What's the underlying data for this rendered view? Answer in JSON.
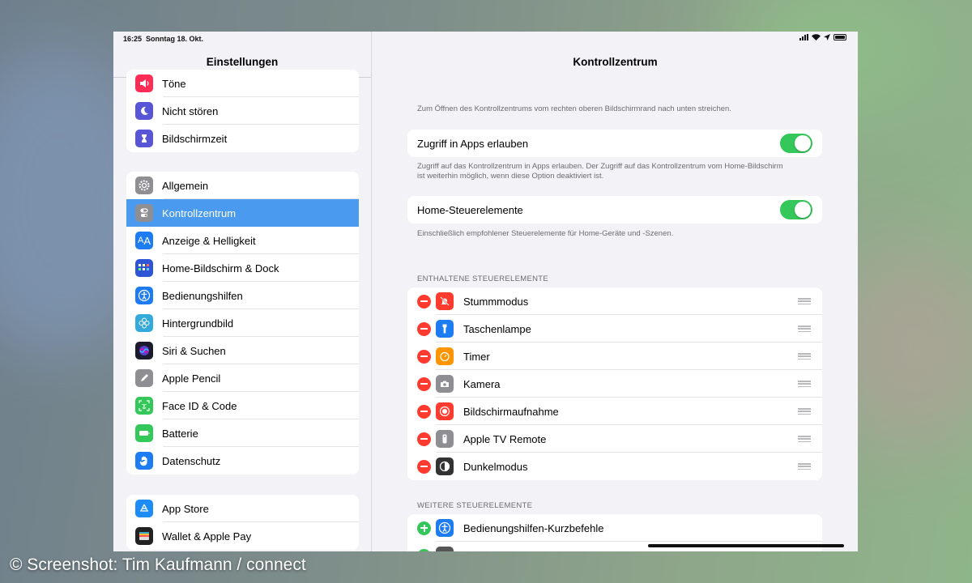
{
  "status": {
    "time": "16:25",
    "date": "Sonntag 18. Okt."
  },
  "sidebar": {
    "title": "Einstellungen",
    "group1": [
      {
        "label": "Töne",
        "icon": "speaker-icon",
        "color": "#ff2d55"
      },
      {
        "label": "Nicht stören",
        "icon": "moon-icon",
        "color": "#5856d6"
      },
      {
        "label": "Bildschirmzeit",
        "icon": "hourglass-icon",
        "color": "#5856d6"
      }
    ],
    "group2": [
      {
        "label": "Allgemein",
        "icon": "gear-icon",
        "color": "#8e8e93"
      },
      {
        "label": "Kontrollzentrum",
        "icon": "switches-icon",
        "color": "#8e8e93",
        "active": true
      },
      {
        "label": "Anzeige & Helligkeit",
        "icon": "text-size-icon",
        "color": "#1e7cf2"
      },
      {
        "label": "Home-Bildschirm & Dock",
        "icon": "app-grid-icon",
        "color": "#2e55d6"
      },
      {
        "label": "Bedienungshilfen",
        "icon": "accessibility-icon",
        "color": "#1e7cf2"
      },
      {
        "label": "Hintergrundbild",
        "icon": "flower-icon",
        "color": "#34aadc"
      },
      {
        "label": "Siri & Suchen",
        "icon": "siri-icon",
        "color": "#222"
      },
      {
        "label": "Apple Pencil",
        "icon": "pencil-icon",
        "color": "#8e8e93"
      },
      {
        "label": "Face ID & Code",
        "icon": "face-id-icon",
        "color": "#34c759"
      },
      {
        "label": "Batterie",
        "icon": "battery-icon",
        "color": "#34c759"
      },
      {
        "label": "Datenschutz",
        "icon": "hand-icon",
        "color": "#1e7cf2"
      }
    ],
    "group3": [
      {
        "label": "App Store",
        "icon": "app-store-icon",
        "color": "#1e8cf7"
      },
      {
        "label": "Wallet & Apple Pay",
        "icon": "wallet-icon",
        "color": "#222"
      }
    ]
  },
  "main": {
    "title": "Kontrollzentrum",
    "intro": "Zum Öffnen des Kontrollzentrums vom rechten oberen Bildschirmrand nach unten streichen.",
    "access_label": "Zugriff in Apps erlauben",
    "access_note": "Zugriff auf das Kontrollzentrum in Apps erlauben. Der Zugriff auf das Kontrollzentrum vom Home-Bildschirm ist weiterhin möglich, wenn diese Option deaktiviert ist.",
    "home_label": "Home-Steuerelemente",
    "home_note": "Einschließlich empfohlener Steuerelemente für Home-Geräte und -Szenen.",
    "included_header": "ENTHALTENE STEUERELEMENTE",
    "included": [
      {
        "label": "Stummmodus",
        "icon": "bell-slash-icon",
        "color": "#ff3b30"
      },
      {
        "label": "Taschenlampe",
        "icon": "flashlight-icon",
        "color": "#1e7cf2"
      },
      {
        "label": "Timer",
        "icon": "timer-icon",
        "color": "#ff9500"
      },
      {
        "label": "Kamera",
        "icon": "camera-icon",
        "color": "#8e8e93"
      },
      {
        "label": "Bildschirmaufnahme",
        "icon": "record-icon",
        "color": "#ff3b30"
      },
      {
        "label": "Apple TV Remote",
        "icon": "remote-icon",
        "color": "#8e8e93"
      },
      {
        "label": "Dunkelmodus",
        "icon": "dark-mode-icon",
        "color": "#333"
      }
    ],
    "more_header": "WEITERE STEUERELEMENTE",
    "more": [
      {
        "label": "Bedienungshilfen-Kurzbefehle",
        "icon": "accessibility-icon",
        "color": "#1e7cf2"
      }
    ]
  },
  "credit": "© Screenshot: Tim Kaufmann / connect"
}
